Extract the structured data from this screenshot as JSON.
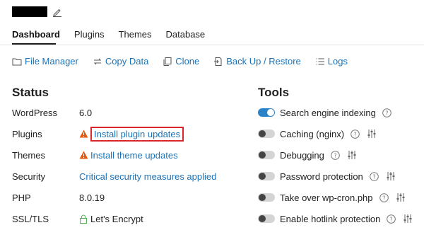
{
  "tabs": [
    "Dashboard",
    "Plugins",
    "Themes",
    "Database"
  ],
  "toolbar": {
    "file_manager": "File Manager",
    "copy_data": "Copy Data",
    "clone": "Clone",
    "backup_restore": "Back Up / Restore",
    "logs": "Logs"
  },
  "status": {
    "title": "Status",
    "rows": [
      {
        "label": "WordPress",
        "value": "6.0"
      },
      {
        "label": "Plugins",
        "value": "Install plugin updates"
      },
      {
        "label": "Themes",
        "value": "Install theme updates"
      },
      {
        "label": "Security",
        "value": "Critical security measures applied"
      },
      {
        "label": "PHP",
        "value": "8.0.19"
      },
      {
        "label": "SSL/TLS",
        "value": "Let's Encrypt"
      }
    ]
  },
  "tools": {
    "title": "Tools",
    "items": [
      {
        "label": "Search engine indexing",
        "enabled": true
      },
      {
        "label": "Caching (nginx)",
        "enabled": false
      },
      {
        "label": "Debugging",
        "enabled": false
      },
      {
        "label": "Password protection",
        "enabled": false
      },
      {
        "label": "Take over wp-cron.php",
        "enabled": false
      },
      {
        "label": "Enable hotlink protection",
        "enabled": false
      }
    ]
  },
  "colors": {
    "link": "#1a73b8",
    "toggle_on": "#2a82c9",
    "warning": "#e8590c",
    "highlight_border": "#d9262c"
  }
}
